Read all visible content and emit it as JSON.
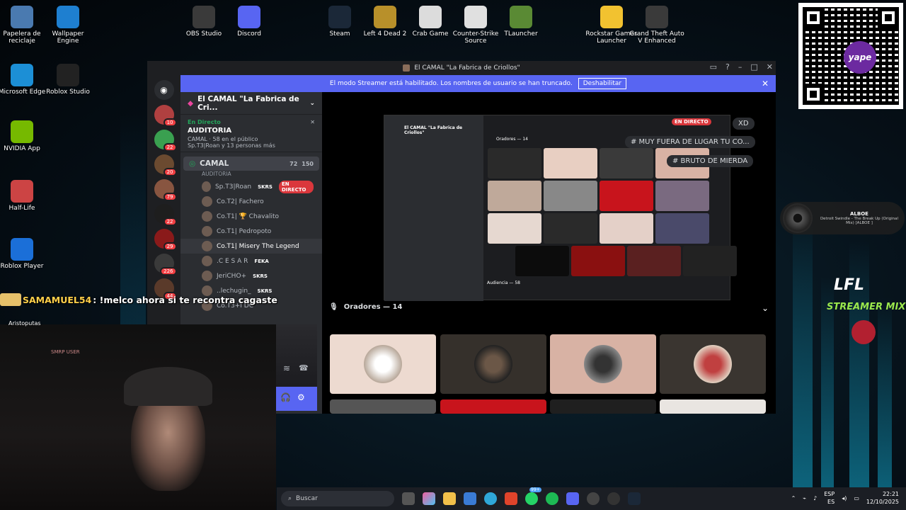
{
  "desktop": {
    "icons": [
      {
        "label": "Papelera de reciclaje",
        "icon": "recycle-bin-icon"
      },
      {
        "label": "Wallpaper Engine",
        "icon": "wallpaper-engine-icon"
      },
      {
        "label": "Microsoft Edge",
        "icon": "edge-icon"
      },
      {
        "label": "Roblox Studio",
        "icon": "roblox-studio-icon"
      },
      {
        "label": "NVIDIA App",
        "icon": "nvidia-icon"
      },
      {
        "label": "Half-Life",
        "icon": "half-life-icon"
      },
      {
        "label": "Roblox Player",
        "icon": "roblox-player-icon"
      },
      {
        "label": "OBS Studio",
        "icon": "obs-icon"
      },
      {
        "label": "Discord",
        "icon": "discord-icon"
      },
      {
        "label": "Steam",
        "icon": "steam-icon"
      },
      {
        "label": "Left 4 Dead 2",
        "icon": "l4d2-icon"
      },
      {
        "label": "Crab Game",
        "icon": "crab-game-icon"
      },
      {
        "label": "Counter-Strike Source",
        "icon": "css-icon"
      },
      {
        "label": "TLauncher",
        "icon": "tlauncher-icon"
      },
      {
        "label": "Rockstar Games Launcher",
        "icon": "rockstar-icon"
      },
      {
        "label": "Grand Theft Auto V Enhanced",
        "icon": "gta-icon"
      }
    ],
    "qr_badge": "yape",
    "overlay_logo": "LFL",
    "overlay_sub": "STREAMER MIX"
  },
  "music": {
    "artist": "ALBOE",
    "track": "Detroit Swindle - The Break Up (Original Mix) [ALBOE ]"
  },
  "chat": {
    "user": "SAMAMUEL54",
    "message": ": !melco ahora si te recontra cagaste",
    "tag": "Aristoputas"
  },
  "webcam": {
    "sign": "SMRP USER"
  },
  "discord": {
    "window_title": "El CAMAL \"La Fabrica de Criollos\"",
    "banner_text": "El modo Streamer está habilitado. Los nombres de usuario se han truncado.",
    "banner_button": "Deshabilitar",
    "guild_name": "El CAMAL \"La Fabrica de Cri...",
    "live_label": "En Directo",
    "live_channel": "AUDITORIA",
    "live_meta": "CAMAL · 58 en el público",
    "live_people": "Sp.T3|Roan y 13 personas más",
    "channel": {
      "name": "CAMAL",
      "sub": "AUDITORIA",
      "count_a": "72",
      "count_b": "150"
    },
    "users": [
      {
        "name": "Sp.T3|Roan",
        "tag": "SKRS",
        "live": "EN DIRECTO"
      },
      {
        "name": "Co.T2| Fachero",
        "tag": "",
        "live": ""
      },
      {
        "name": "Co.T1| 🏆 Chavalito",
        "tag": "",
        "live": ""
      },
      {
        "name": "Co.T1| Pedropoto",
        "tag": "",
        "live": ""
      },
      {
        "name": "Co.T1| Misery The Legend",
        "tag": "",
        "live": ""
      },
      {
        "name": ".C E S A R",
        "tag": "FEKA",
        "live": ""
      },
      {
        "name": "JeriCHO+",
        "tag": "SKRS",
        "live": ""
      },
      {
        "name": "..lechugin_",
        "tag": "SKRS",
        "live": ""
      },
      {
        "name": "Co.T3+I DC",
        "tag": "",
        "live": ""
      }
    ],
    "server_counts": [
      "10",
      "22",
      "20",
      "79",
      "22",
      "29",
      "226",
      "44"
    ],
    "stage_header": "Oradores — 14",
    "stream_chips": [
      "XD",
      "# MUY FUERA DE LUGAR TU CO...",
      "# BRUTO DE MIERDA"
    ],
    "stream_badge": "EN DIRECTO",
    "stream_inner_title": "El CAMAL \"La Fabrica de Criollos\"",
    "stream_inner_oradores": "Oradores — 14",
    "stream_inner_audiencia": "Audiencia — 58"
  },
  "taskbar": {
    "search_placeholder": "Buscar",
    "lang_top": "ESP",
    "lang_bottom": "ES",
    "time": "22:21",
    "date": "12/10/2025",
    "badge": "99+"
  }
}
